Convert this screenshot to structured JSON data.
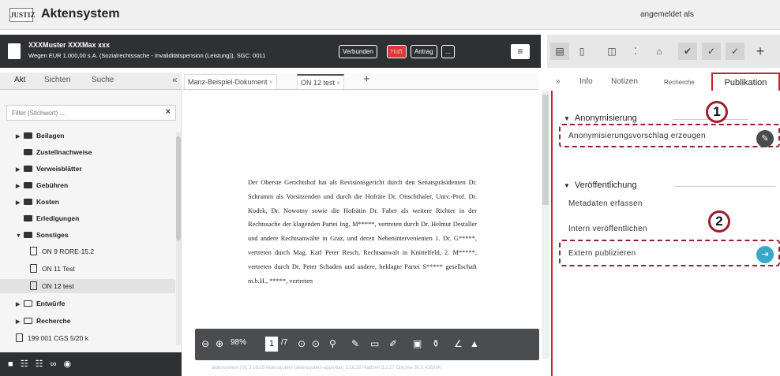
{
  "app": {
    "logo": "JUSTIZ",
    "title": "Aktensystem",
    "user": "angemeldet als"
  },
  "casebar": {
    "line1": "XXXMuster XXXMax xxx",
    "line2": "Wegen EUR 1.000,00 s.A. (Sozialrechtssache - Invaliditätspension (Leistung)), SGC: 0011",
    "tags": [
      "Verbunden",
      "Haft",
      "Antrag",
      "..."
    ],
    "menu_icon": "≡"
  },
  "right_toolbar": {
    "icons": [
      "doc-color-icon",
      "doc-icon",
      "panel-icon",
      "grid-icon",
      "home-icon",
      "check-icon",
      "check-less-icon",
      "check-less-icon",
      "plus-icon"
    ],
    "plus": "+"
  },
  "left": {
    "tabs": [
      "Akt",
      "Sichten",
      "Suche"
    ],
    "collapse": "«",
    "filter_placeholder": "Filter (Stichwort) ...",
    "filter_clear": "×",
    "tree": [
      {
        "label": "Beilagen",
        "type": "folder",
        "caret": "▶"
      },
      {
        "label": "Zustellnachweise",
        "type": "folder",
        "caret": ""
      },
      {
        "label": "Verweisblätter",
        "type": "folder",
        "caret": "▶"
      },
      {
        "label": "Gebühren",
        "type": "folder",
        "caret": "▶"
      },
      {
        "label": "Kosten",
        "type": "folder",
        "caret": "▶"
      },
      {
        "label": "Erledigungen",
        "type": "folder",
        "caret": ""
      },
      {
        "label": "Sonstiges",
        "type": "folder-open",
        "caret": "▼"
      },
      {
        "label": "ON 9 RORE-15.2",
        "type": "doc",
        "caret": ""
      },
      {
        "label": "ON 11 Test",
        "type": "doc",
        "caret": ""
      },
      {
        "label": "ON 12 test",
        "type": "doc",
        "caret": "",
        "selected": true
      },
      {
        "label": "Entwürfe",
        "type": "folder-outline",
        "caret": "▶"
      },
      {
        "label": "Recherche",
        "type": "folder-outline",
        "caret": "▶"
      },
      {
        "label": "199 001 CGS 5/20 k",
        "type": "case",
        "caret": ""
      }
    ]
  },
  "center": {
    "tabs": [
      {
        "label": "Manz-Beispiel-Dokument",
        "close": "×"
      },
      {
        "label": "ON 12 test",
        "close": "×"
      }
    ],
    "new_tab": "+",
    "document_text": "Der Oberste Gerichtshof hat als Revisionsgericht durch den Senatspräsidenten Dr. Schramm als Vorsitzenden und durch die Hofräte Dr. Oitschthaler, Univ.-Prof. Dr. Kodek, Dr. Nowotny sowie die Hofrätin Dr. Faber als weitere Richter in der Rechtssache der klagenden Partei Ing. M*****, vertreten durch Dr. Helmut Destaller und andere Rechtsanwälte in Graz, und deren Nebenintervenienten 1. Dr. G*****, vertreten durch Mag. Karl Peter Resch, Rechtsanwalt in Knittelfeld, 2. M*****, vertreten durch Dr. Peter Schaden und andere, beklagte Partei S***** gesellschaft m.b.H., *****, vertreten",
    "viewer": {
      "zoom": "98%",
      "page": "1",
      "pages": "/7"
    },
    "footer": "aktensystem (UI) 3.16.25 Aktensystem (aktensystem-apps-bar) 3.16.39 Platform 3.2.27 Chrome 89.0.4389.90"
  },
  "right": {
    "tabs": [
      "»",
      "Info",
      "Notizen",
      "Recherche",
      "Publikation"
    ],
    "sections": {
      "anon": {
        "title": "Anonymisierung",
        "item": "Anonymisierungsvorschlag erzeugen",
        "badge": "1"
      },
      "pub": {
        "title": "Veröffentlichung",
        "items": [
          "Metadaten erfassen",
          "Intern veröffentlichen",
          "Extern publizieren"
        ],
        "badge": "2"
      }
    },
    "colors": {
      "accent": "#c0282f",
      "edit_button": "#4a4d50",
      "publish_button": "#3aa8c8"
    }
  }
}
